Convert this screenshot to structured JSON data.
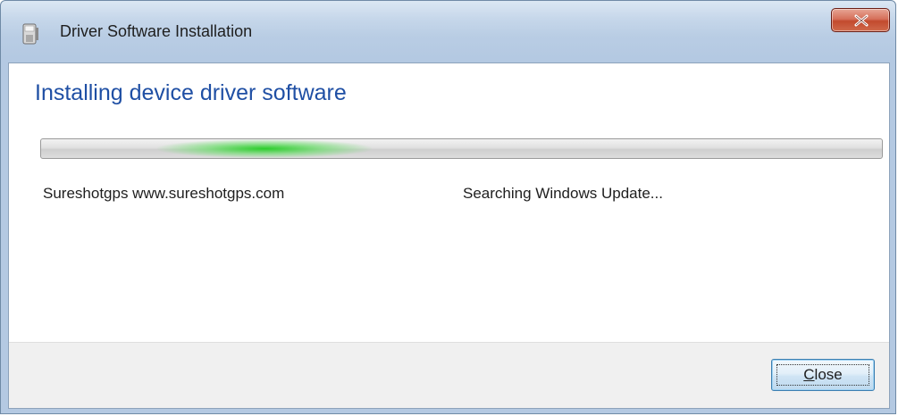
{
  "window": {
    "title": "Driver Software Installation",
    "app_icon": "usb-drive-icon",
    "close_icon": "close-x-icon"
  },
  "main": {
    "heading": "Installing device driver software",
    "progress": {
      "style": "marquee-indeterminate",
      "accent_color": "#22cd22"
    },
    "device_name": "Sureshotgps www.sureshotgps.com",
    "status": "Searching Windows Update..."
  },
  "footer": {
    "close_label": "Close"
  }
}
